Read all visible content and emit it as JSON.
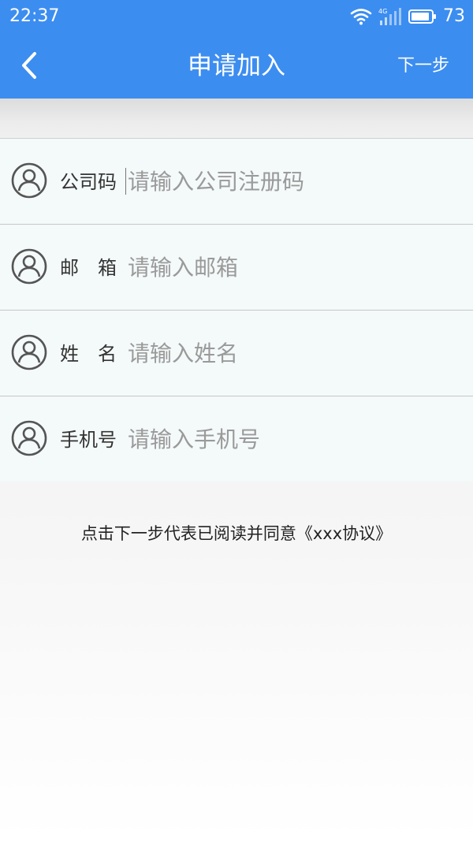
{
  "status_bar": {
    "time": "22:37",
    "network": "4G",
    "battery": "73",
    "icons": [
      "wifi-icon",
      "signal-icon",
      "battery-icon"
    ]
  },
  "nav": {
    "back_icon": "chevron-left-icon",
    "title": "申请加入",
    "next_label": "下一步"
  },
  "form": {
    "rows": [
      {
        "icon": "user-icon",
        "label": "公司码",
        "placeholder": "请输入公司注册码",
        "value": "",
        "focused": true
      },
      {
        "icon": "user-icon",
        "label": "邮　箱",
        "placeholder": "请输入邮箱",
        "value": ""
      },
      {
        "icon": "user-icon",
        "label": "姓　名",
        "placeholder": "请输入姓名",
        "value": ""
      },
      {
        "icon": "user-icon",
        "label": "手机号",
        "placeholder": "请输入手机号",
        "value": ""
      }
    ]
  },
  "agreement": "点击下一步代表已阅读并同意《xxx协议》",
  "colors": {
    "primary": "#3c8df0",
    "form_bg": "#f4f9f9",
    "placeholder": "#9a9a9a"
  }
}
